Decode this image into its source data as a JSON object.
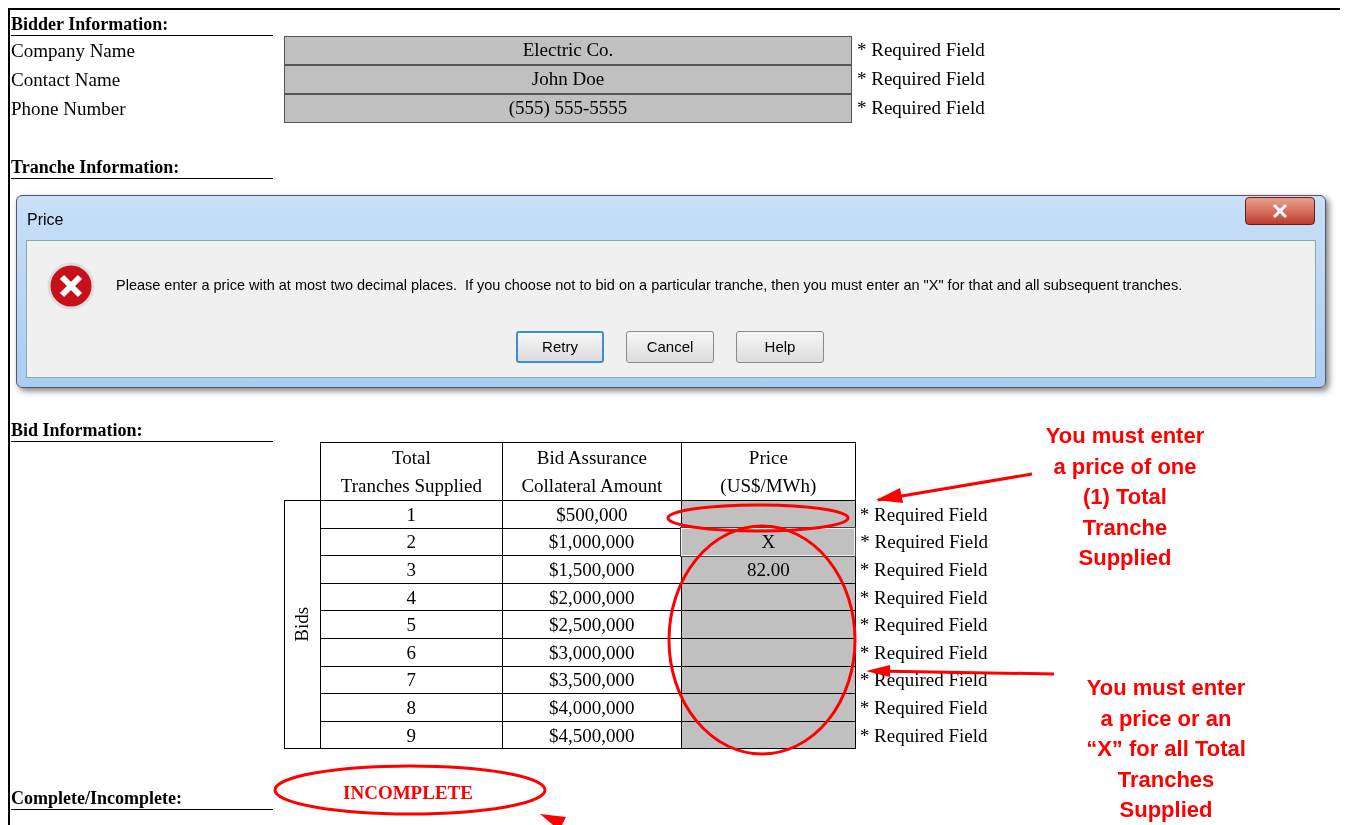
{
  "bidder": {
    "heading": "Bidder Information:",
    "fields": [
      {
        "label": "Company Name",
        "value": "Electric Co.",
        "note": "* Required Field"
      },
      {
        "label": "Contact Name",
        "value": "John Doe",
        "note": "* Required Field"
      },
      {
        "label": "Phone Number",
        "value": "(555) 555-5555",
        "note": "* Required Field"
      }
    ]
  },
  "tranche": {
    "heading": "Tranche Information:"
  },
  "bid": {
    "heading": "Bid Information:",
    "columns": [
      [
        "Total",
        "Tranches Supplied"
      ],
      [
        "Bid Assurance",
        "Collateral Amount"
      ],
      [
        "Price",
        "(US$/MWh)"
      ]
    ],
    "side_label": "Bids",
    "rows": [
      {
        "tranches": "1",
        "collateral": "$500,000",
        "note": "* Required Field"
      },
      {
        "tranches": "2",
        "collateral": "$1,000,000",
        "price": "X",
        "selected": true,
        "note": "* Required Field"
      },
      {
        "tranches": "3",
        "collateral": "$1,500,000",
        "price": "82.00",
        "selected": false,
        "note": "* Required Field"
      },
      {
        "tranches": "4",
        "collateral": "$2,000,000",
        "note": "* Required Field"
      },
      {
        "tranches": "5",
        "collateral": "$2,500,000",
        "note": "* Required Field"
      },
      {
        "tranches": "6",
        "collateral": "$3,000,000",
        "note": "* Required Field"
      },
      {
        "tranches": "7",
        "collateral": "$3,500,000",
        "note": "* Required Field"
      },
      {
        "tranches": "8",
        "collateral": "$4,000,000",
        "note": "* Required Field"
      },
      {
        "tranches": "9",
        "collateral": "$4,500,000",
        "note": "* Required Field"
      }
    ]
  },
  "status": {
    "label": "Complete/Incomplete:",
    "value": "INCOMPLETE"
  },
  "dialog": {
    "title": "Price",
    "message": "Please enter a price with at most two decimal places.  If you choose not to bid on a particular tranche, then you must enter an \"X\" for that and all subsequent tranches.",
    "buttons": [
      {
        "label": "Retry",
        "selected": true
      },
      {
        "label": "Cancel",
        "selected": false
      },
      {
        "label": "Help",
        "selected": false
      }
    ]
  },
  "annotations": [
    {
      "lines": [
        "You must enter",
        "a price of one",
        "(1) Total",
        "Tranche",
        "Supplied"
      ]
    },
    {
      "lines": [
        "You must enter",
        "a price or an",
        "“X” for all Total",
        "Tranches",
        "Supplied"
      ]
    }
  ]
}
